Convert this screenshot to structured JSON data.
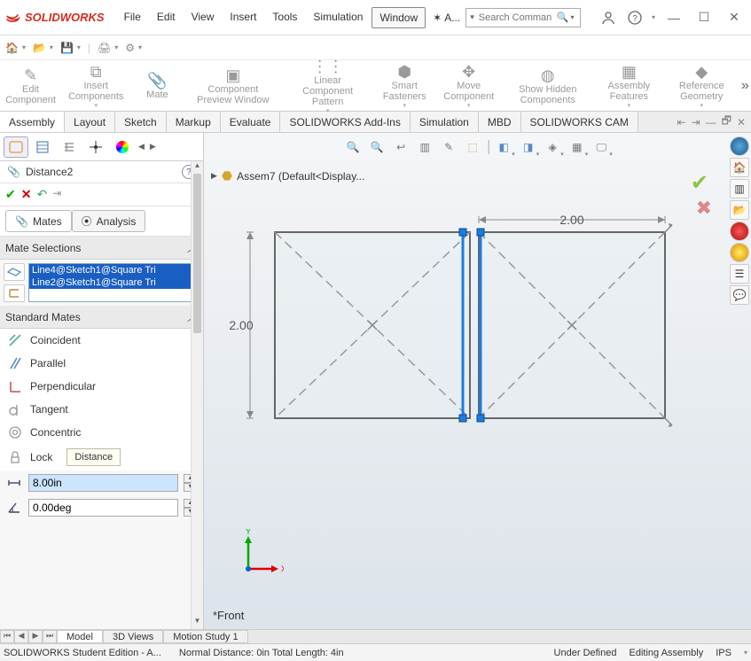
{
  "app": {
    "brand": "SOLIDWORKS"
  },
  "menu": [
    "File",
    "Edit",
    "View",
    "Insert",
    "Tools",
    "Simulation",
    "Window"
  ],
  "menu_active_index": 6,
  "title_extra_label": "A...",
  "search_placeholder": "Search Comman",
  "ribbon": [
    {
      "label": "Edit Component"
    },
    {
      "label": "Insert Components"
    },
    {
      "label": "Mate"
    },
    {
      "label": "Component Preview Window"
    },
    {
      "label": "Linear Component Pattern"
    },
    {
      "label": "Smart Fasteners"
    },
    {
      "label": "Move Component"
    },
    {
      "label": "Show Hidden Components"
    },
    {
      "label": "Assembly Features"
    },
    {
      "label": "Reference Geometry"
    }
  ],
  "tabs": [
    "Assembly",
    "Layout",
    "Sketch",
    "Markup",
    "Evaluate",
    "SOLIDWORKS Add-Ins",
    "Simulation",
    "MBD",
    "SOLIDWORKS CAM"
  ],
  "tabs_active_index": 0,
  "doc_name": "Assem7  (Default<Display...",
  "property_manager": {
    "title": "Distance2",
    "mates_tab": "Mates",
    "analysis_tab": "Analysis",
    "mate_selections_header": "Mate Selections",
    "selections": [
      "Line4@Sketch1@Square Tri",
      "Line2@Sketch1@Square Tri"
    ],
    "standard_mates_header": "Standard Mates",
    "mates": [
      {
        "name": "coincident",
        "label": "Coincident"
      },
      {
        "name": "parallel",
        "label": "Parallel"
      },
      {
        "name": "perpendicular",
        "label": "Perpendicular"
      },
      {
        "name": "tangent",
        "label": "Tangent"
      },
      {
        "name": "concentric",
        "label": "Concentric"
      },
      {
        "name": "lock",
        "label": "Lock"
      }
    ],
    "distance_tooltip": "Distance",
    "distance_value": "8.00in",
    "angle_value": "0.00deg"
  },
  "drawing": {
    "dim_top": "2.00",
    "dim_left": "2.00"
  },
  "view_label": "*Front",
  "bottom_tabs": [
    "Model",
    "3D Views",
    "Motion Study 1"
  ],
  "bottom_active_index": 0,
  "status": {
    "left1": "SOLIDWORKS Student Edition - A...",
    "left2": "Normal Distance: 0in Total Length: 4in",
    "under": "Under Defined",
    "mode": "Editing Assembly",
    "units": "IPS"
  }
}
